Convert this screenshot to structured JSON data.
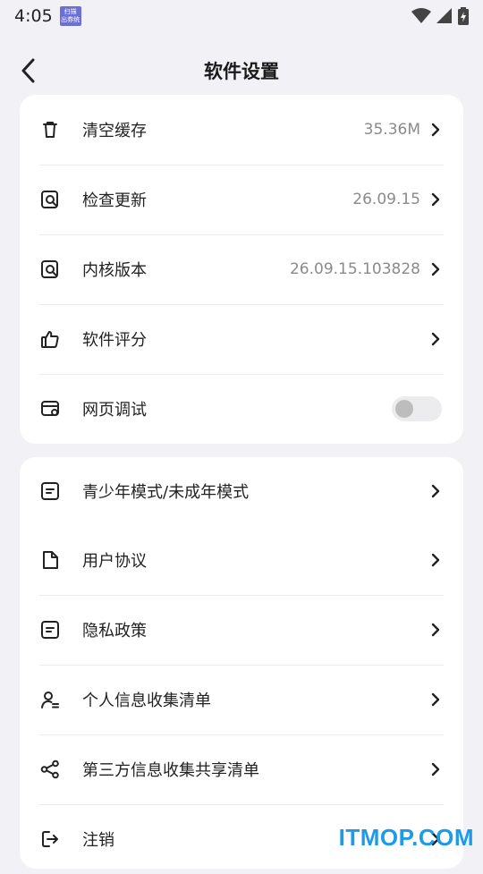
{
  "status_bar": {
    "time": "4:05",
    "app_icon_text": "扫描\n出券统"
  },
  "header": {
    "title": "软件设置"
  },
  "group1": [
    {
      "label": "清空缓存",
      "value": "35.36M",
      "icon": "trash-icon"
    },
    {
      "label": "检查更新",
      "value": "26.09.15",
      "icon": "search-doc-icon"
    },
    {
      "label": "内核版本",
      "value": "26.09.15.103828",
      "icon": "search-doc-icon"
    },
    {
      "label": "软件评分",
      "value": "",
      "icon": "thumbs-up-icon"
    },
    {
      "label": "网页调试",
      "toggle": false,
      "icon": "browser-settings-icon"
    }
  ],
  "group2": [
    {
      "label": "青少年模式/未成年模式",
      "icon": "note-icon"
    },
    {
      "label": "用户协议",
      "icon": "document-icon"
    },
    {
      "label": "隐私政策",
      "icon": "note-icon"
    },
    {
      "label": "个人信息收集清单",
      "icon": "user-list-icon"
    },
    {
      "label": "第三方信息收集共享清单",
      "icon": "share-icon"
    },
    {
      "label": "注销",
      "icon": "logout-icon"
    }
  ],
  "watermark": "ITMOP.COM",
  "colors": {
    "background": "#f2f2f6",
    "card": "#ffffff",
    "muted_text": "#8a8a8a",
    "watermark": "#1e9be6"
  }
}
